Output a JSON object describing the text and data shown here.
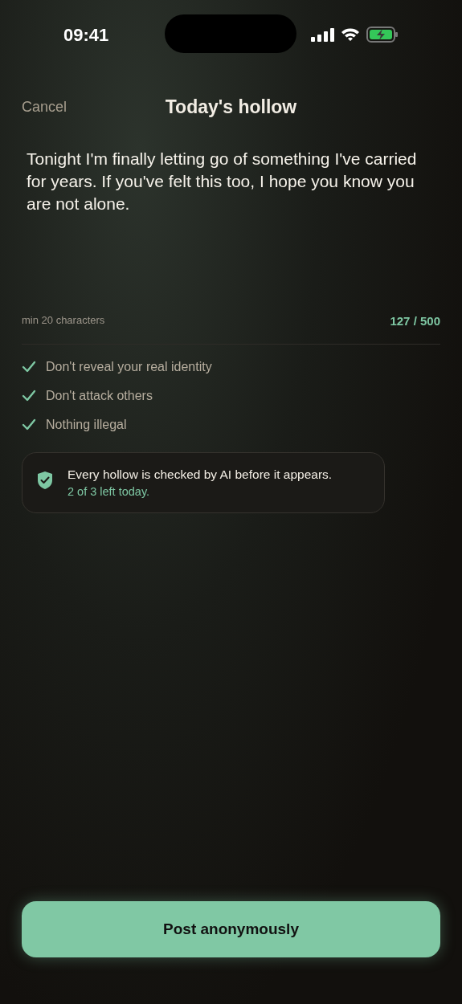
{
  "status_bar": {
    "time": "09:41"
  },
  "nav": {
    "cancel": "Cancel",
    "title": "Today's hollow"
  },
  "post": {
    "value": "Tonight I'm finally letting go of something I've carried for years. If you've felt this too, I hope you know you are not alone.",
    "hint": "min 20 characters",
    "count": "127 / 500"
  },
  "rules": [
    {
      "text": "Don't reveal your real identity",
      "checked": true
    },
    {
      "text": "Don't attack others",
      "checked": true
    },
    {
      "text": "Nothing illegal",
      "checked": true
    }
  ],
  "notice": {
    "text": "Every hollow is checked by AI before it appears.",
    "quota": "2 of 3 left today."
  },
  "button": "Post anonymously"
}
